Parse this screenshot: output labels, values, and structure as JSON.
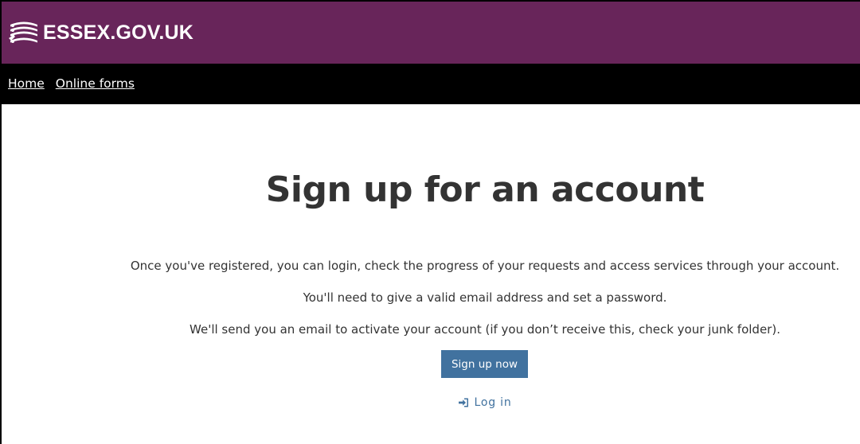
{
  "header": {
    "site_name": "ESSEX.GOV.UK",
    "logo_icon": "essex-seaxes-logo-icon",
    "background": "#68255A"
  },
  "nav": {
    "background": "#000000",
    "items": [
      {
        "label": "Home"
      },
      {
        "label": "Online forms"
      }
    ]
  },
  "main": {
    "title": "Sign up for an account",
    "paragraphs": [
      "Once you've registered, you can login, check the progress of your requests and access services through your account.",
      "You'll need to give a valid email address and set a password.",
      "We'll send you an email to activate your account (if you don’t receive this, check your junk folder)."
    ],
    "signup_button_label": "Sign up now",
    "signup_button_color": "#41729F",
    "login_label": "Log in",
    "login_icon": "sign-in-icon",
    "link_color": "#41729F"
  }
}
